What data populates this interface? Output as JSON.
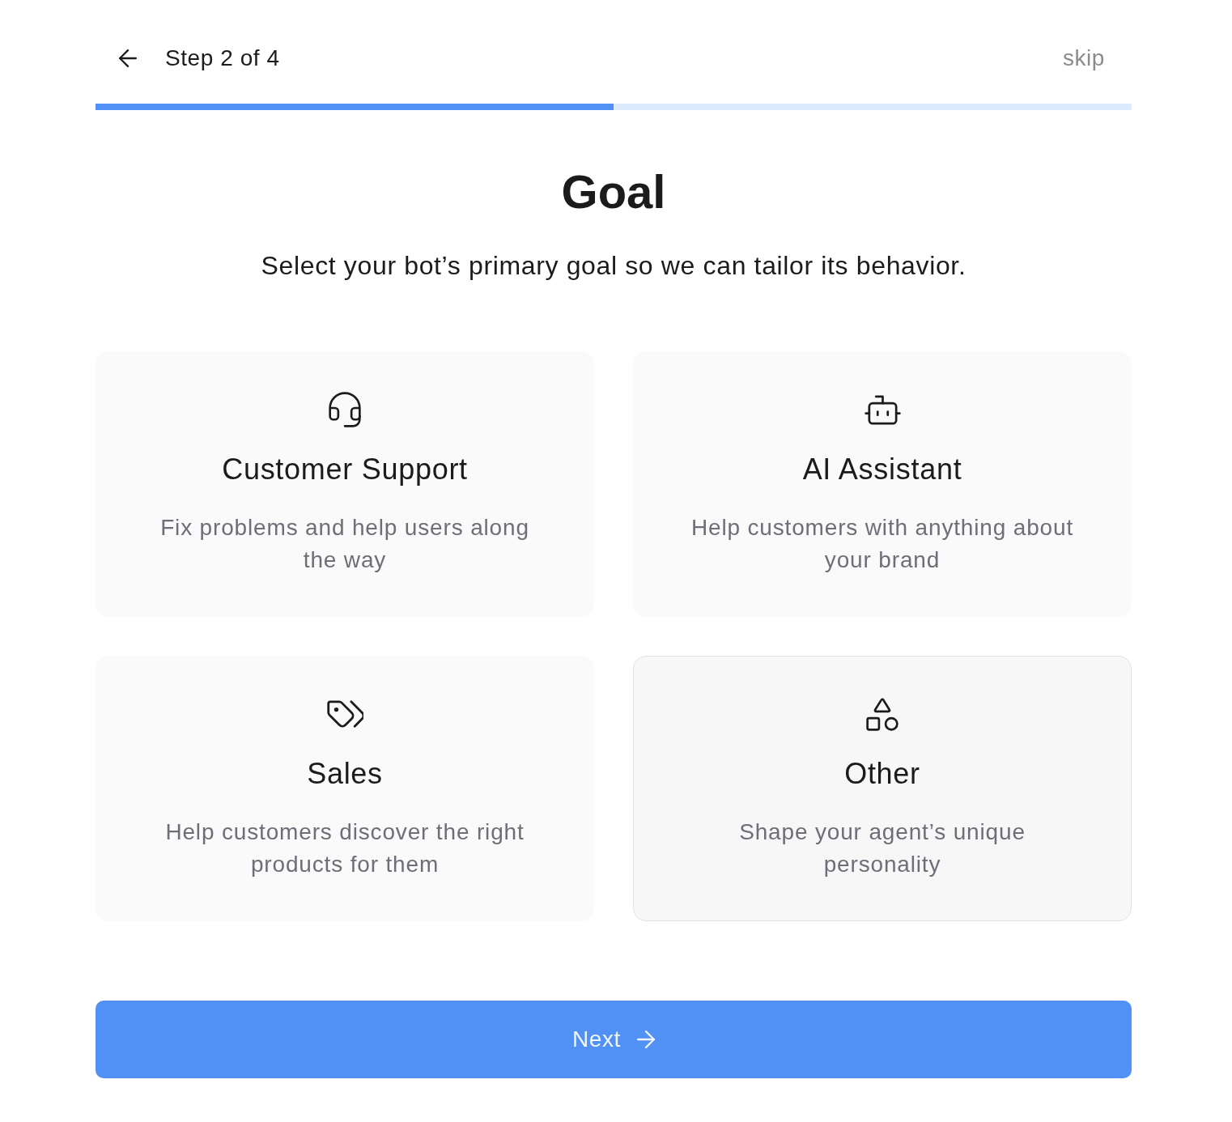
{
  "header": {
    "step": "Step 2 of 4",
    "skip": "skip"
  },
  "progress": {
    "level": 0.5
  },
  "title": "Goal",
  "subtitle": "Select your bot’s primary goal so we can tailor its behavior.",
  "options": [
    {
      "kind": "headset",
      "title": "Customer Support",
      "description": "Fix problems and help users along the way",
      "selected": false
    },
    {
      "kind": "robot",
      "title": "AI Assistant",
      "description": "Help customers with anything about your brand",
      "selected": false
    },
    {
      "kind": "tags",
      "title": "Sales",
      "description": "Help customers discover the right products for them",
      "selected": false
    },
    {
      "kind": "shapes",
      "title": "Other",
      "description": "Shape your agent’s unique personality",
      "selected": true
    }
  ],
  "next_button": {
    "label": "Next"
  }
}
